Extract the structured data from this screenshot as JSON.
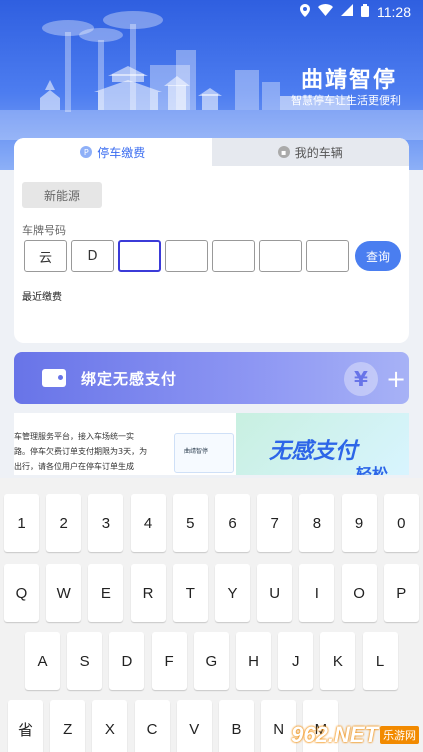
{
  "status_bar": {
    "time": "11:28",
    "icons": [
      "location-icon",
      "wifi-icon",
      "signal-icon",
      "battery-icon"
    ]
  },
  "header": {
    "title": "曲靖智停",
    "subtitle": "智慧停车让生活更便利"
  },
  "tabs": [
    {
      "label": "停车缴费",
      "icon": "parking-icon",
      "icon_glyph": "P"
    },
    {
      "label": "我的车辆",
      "icon": "car-icon",
      "icon_glyph": "▪"
    }
  ],
  "form": {
    "new_energy_label": "新能源",
    "plate_label": "车牌号码",
    "plate_cells": [
      "云",
      "D",
      "",
      "",
      "",
      "",
      ""
    ],
    "query_label": "查询",
    "recent_label": "最近缴费"
  },
  "bind_banner": {
    "text": "绑定无感支付",
    "yen": "¥",
    "plus": "+"
  },
  "promo": {
    "lines": [
      "车管理服务平台，接入车场统一实",
      "路。停车欠费订单支付期限为3天，为",
      "出行，请各位用户在停车订单生成"
    ],
    "mini_label": "曲靖智停",
    "big_text": "无感支付",
    "big_text_2": "轻松"
  },
  "keyboard": {
    "rows": [
      [
        "1",
        "2",
        "3",
        "4",
        "5",
        "6",
        "7",
        "8",
        "9",
        "0"
      ],
      [
        "Q",
        "W",
        "E",
        "R",
        "T",
        "Y",
        "U",
        "I",
        "O",
        "P"
      ],
      [
        "A",
        "S",
        "D",
        "F",
        "G",
        "H",
        "J",
        "K",
        "L"
      ],
      [
        "省",
        "Z",
        "X",
        "C",
        "V",
        "B",
        "N",
        "M"
      ]
    ]
  },
  "watermark": {
    "logo": "962.NET",
    "sub": "乐游网"
  },
  "colors": {
    "accent": "#4a7ef0",
    "hero_top": "#2f5fe0",
    "banner": "#6874e8",
    "focus": "#3b3bd8"
  }
}
